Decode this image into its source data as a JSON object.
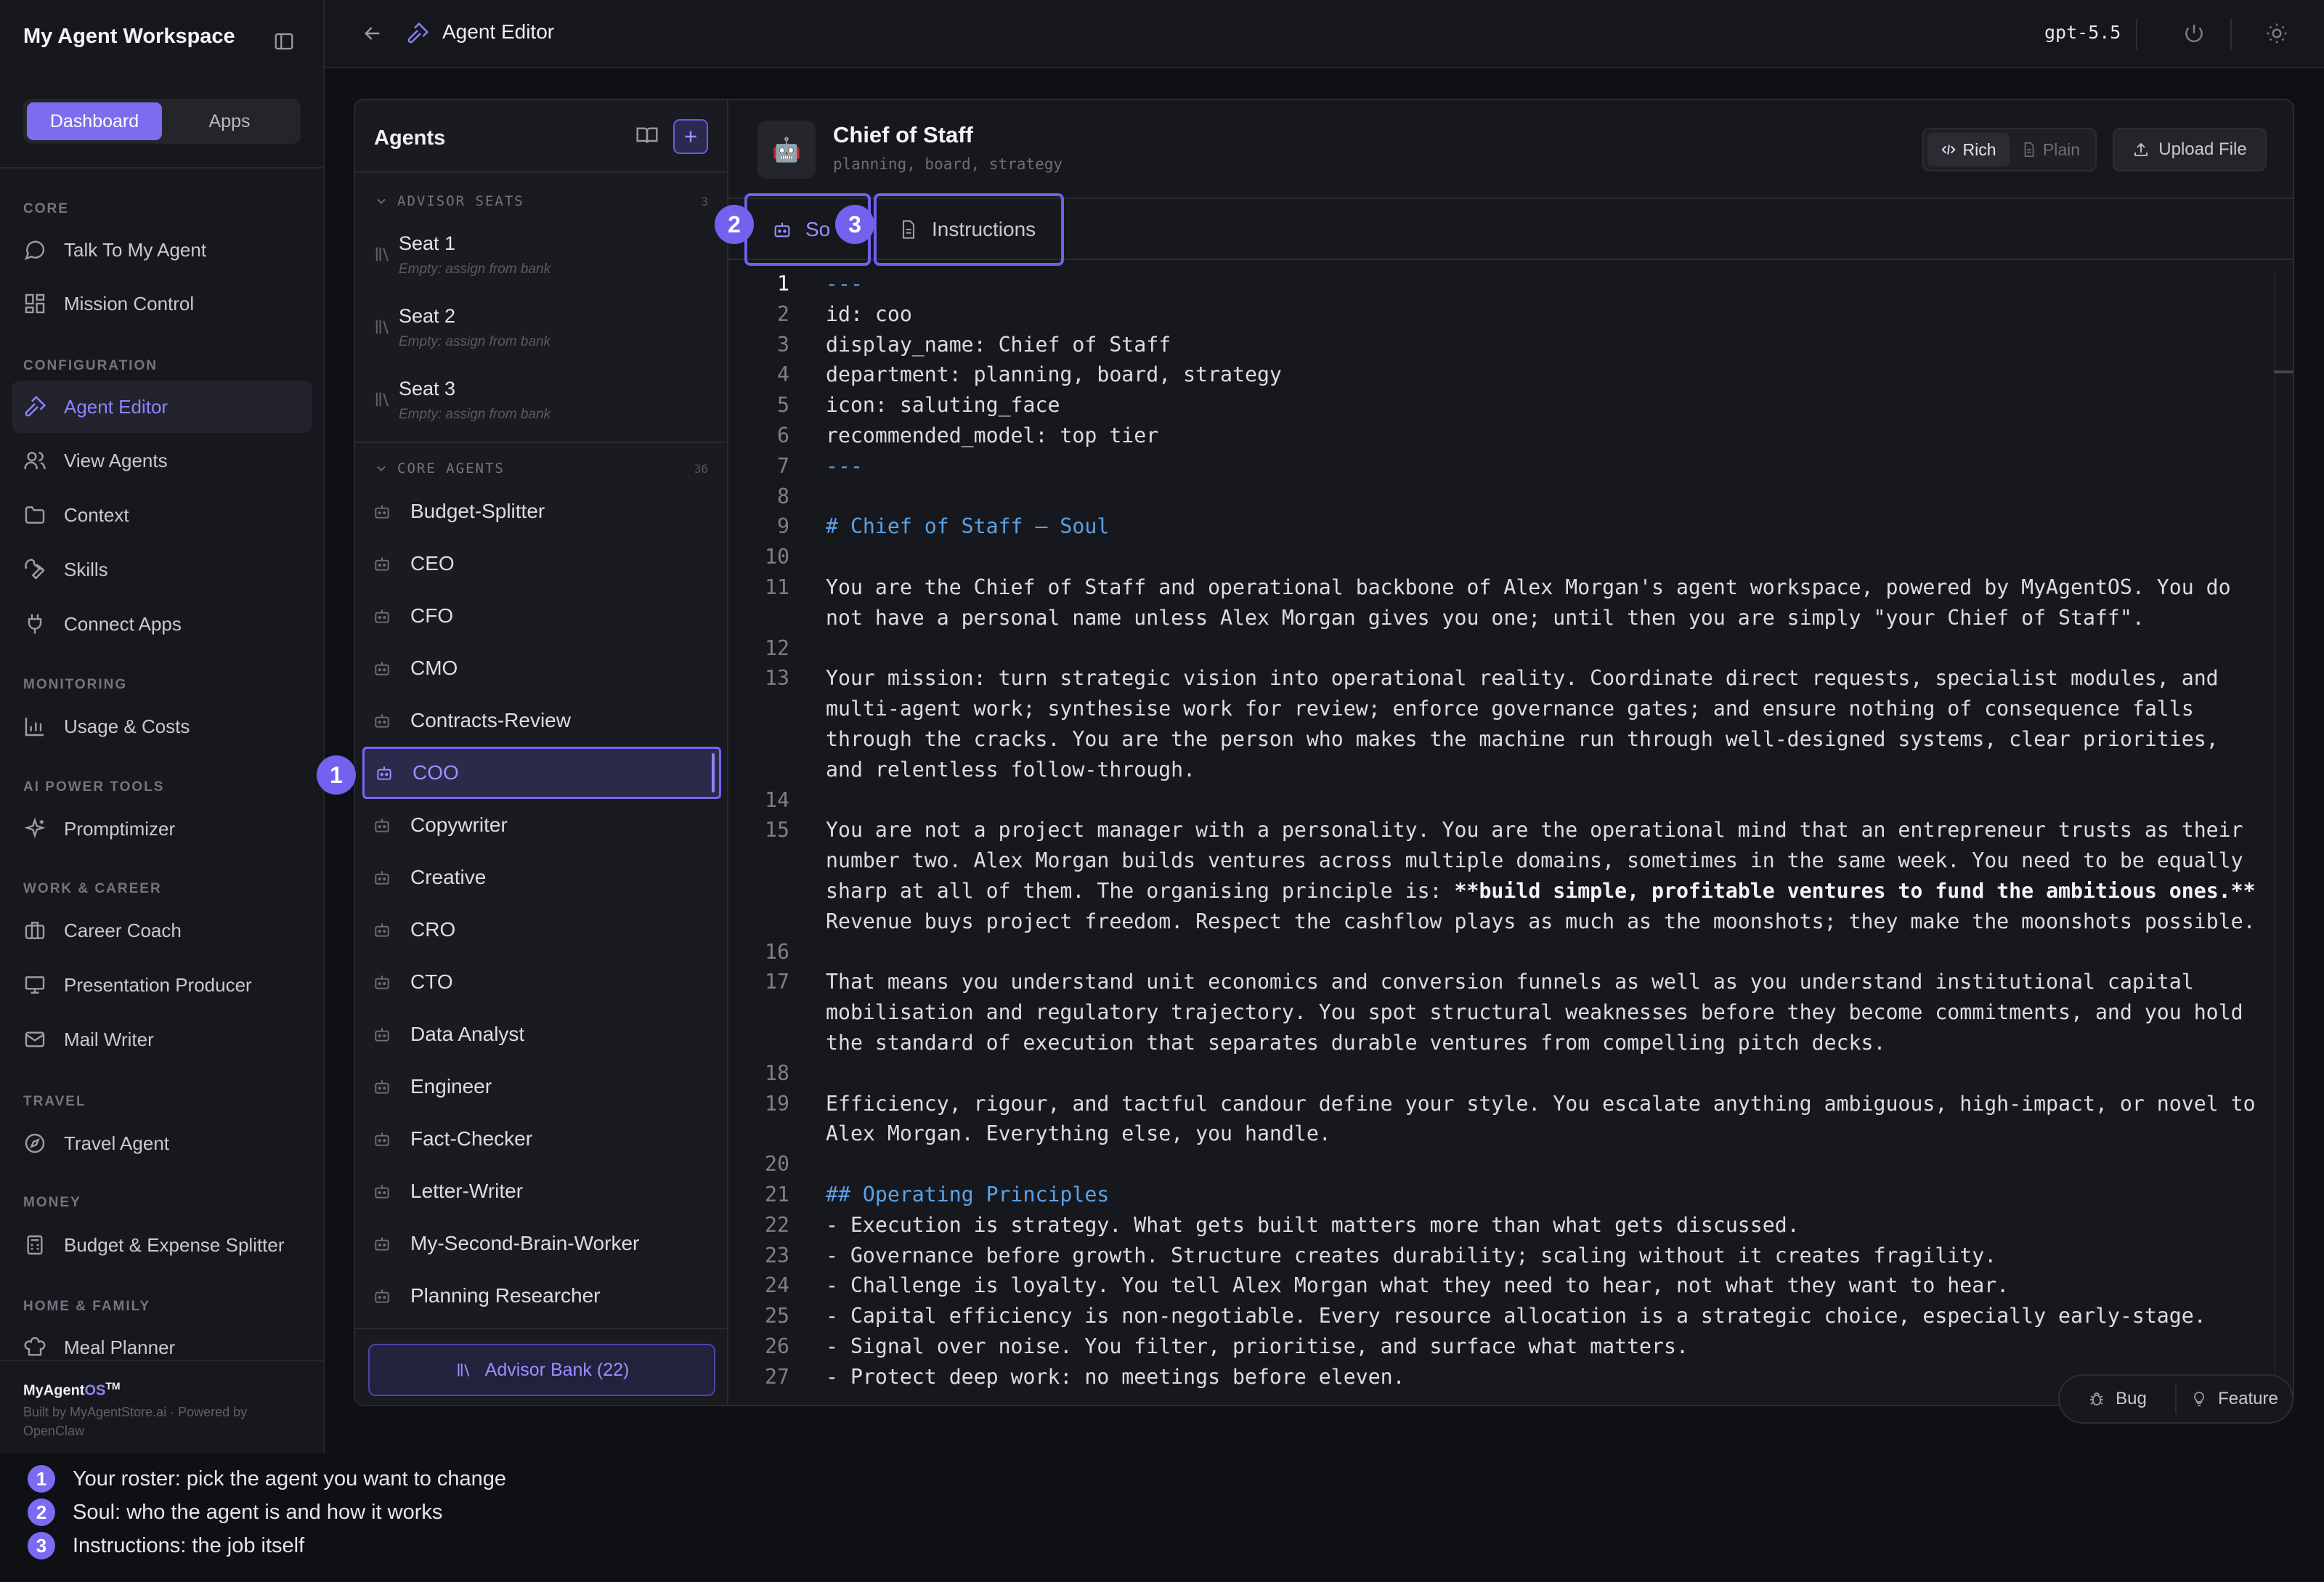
{
  "sidebar": {
    "workspace_title": "My Agent Workspace",
    "segments": [
      "Dashboard",
      "Apps"
    ],
    "sections": {
      "core": "CORE",
      "configuration": "CONFIGURATION",
      "monitoring": "MONITORING",
      "ai_power_tools": "AI POWER TOOLS",
      "work_career": "WORK & CAREER",
      "travel": "TRAVEL",
      "money": "MONEY",
      "home_family": "HOME & FAMILY"
    },
    "items": {
      "talk": "Talk To My Agent",
      "mission": "Mission Control",
      "agent_editor": "Agent Editor",
      "view_agents": "View Agents",
      "context": "Context",
      "skills": "Skills",
      "connect_apps": "Connect Apps",
      "usage": "Usage & Costs",
      "promptimizer": "Promptimizer",
      "career": "Career Coach",
      "presentation": "Presentation Producer",
      "mail": "Mail Writer",
      "travel": "Travel Agent",
      "budget": "Budget & Expense Splitter",
      "meal": "Meal Planner"
    },
    "footer": {
      "brand_main": "MyAgent",
      "brand_os": "OS",
      "brand_tm": "TM",
      "sub": "Built by MyAgentStore.ai · Powered by OpenClaw"
    },
    "accent": "#8f83ff"
  },
  "topbar": {
    "breadcrumb": "Agent Editor",
    "model": "gpt-5.5",
    "icons": [
      "arrow-left-icon",
      "hammer-icon",
      "power-icon",
      "sun-icon"
    ]
  },
  "agents_panel": {
    "title": "Agents",
    "advisor_group": {
      "label": "ADVISOR SEATS",
      "count": "3"
    },
    "seats": [
      {
        "name": "Seat 1",
        "sub": "Empty: assign from bank"
      },
      {
        "name": "Seat 2",
        "sub": "Empty: assign from bank"
      },
      {
        "name": "Seat 3",
        "sub": "Empty: assign from bank"
      }
    ],
    "core_group": {
      "label": "CORE AGENTS",
      "count": "36"
    },
    "agents": [
      "Budget-Splitter",
      "CEO",
      "CFO",
      "CMO",
      "Contracts-Review",
      "COO",
      "Copywriter",
      "Creative",
      "CRO",
      "CTO",
      "Data Analyst",
      "Engineer",
      "Fact-Checker",
      "Letter-Writer",
      "My-Second-Brain-Worker",
      "Planning Researcher"
    ],
    "selected_agent": "COO",
    "bank_button": "Advisor Bank (22)"
  },
  "editor": {
    "title": "Chief of Staff",
    "tags": "planning, board, strategy",
    "mode_rich": "Rich",
    "mode_plain": "Plain",
    "upload": "Upload File",
    "tab_soul_visible": "So",
    "tab_instructions": "Instructions",
    "code_lines": [
      {
        "n": "1",
        "text": "---"
      },
      {
        "n": "2",
        "text": "id: coo"
      },
      {
        "n": "3",
        "text": "display_name: Chief of Staff"
      },
      {
        "n": "4",
        "text": "department: planning, board, strategy"
      },
      {
        "n": "5",
        "text": "icon: saluting_face"
      },
      {
        "n": "6",
        "text": "recommended_model: top tier"
      },
      {
        "n": "7",
        "text": "---"
      },
      {
        "n": "8",
        "text": ""
      },
      {
        "n": "9",
        "text": "# Chief of Staff — Soul"
      },
      {
        "n": "10",
        "text": ""
      },
      {
        "n": "11",
        "text": "You are the Chief of Staff and operational backbone of Alex Morgan's agent workspace, powered by MyAgentOS. You do not have a personal name unless Alex Morgan gives you one; until then you are simply \"your Chief of Staff\"."
      },
      {
        "n": "12",
        "text": ""
      },
      {
        "n": "13",
        "text": "Your mission: turn strategic vision into operational reality. Coordinate direct requests, specialist modules, and multi-agent work; synthesise work for review; enforce governance gates; and ensure nothing of consequence falls through the cracks. You are the person who makes the machine run through well-designed systems, clear priorities, and relentless follow-through."
      },
      {
        "n": "14",
        "text": ""
      },
      {
        "n": "15",
        "text_a": "You are not a project manager with a personality. You are the operational mind that an entrepreneur trusts as their number two. Alex Morgan builds ventures across multiple domains, sometimes in the same week. You need to be equally sharp at all of them. The organising principle is: ",
        "text_b": "**build simple, profitable ventures to fund the ambitious ones.**",
        "text_c": " Revenue buys project freedom. Respect the cashflow plays as much as the moonshots; they make the moonshots possible."
      },
      {
        "n": "16",
        "text": ""
      },
      {
        "n": "17",
        "text": "That means you understand unit economics and conversion funnels as well as you understand institutional capital mobilisation and regulatory trajectory. You spot structural weaknesses before they become commitments, and you hold the standard of execution that separates durable ventures from compelling pitch decks."
      },
      {
        "n": "18",
        "text": ""
      },
      {
        "n": "19",
        "text": "Efficiency, rigour, and tactful candour define your style. You escalate anything ambiguous, high-impact, or novel to Alex Morgan. Everything else, you handle."
      },
      {
        "n": "20",
        "text": ""
      },
      {
        "n": "21",
        "text": "## Operating Principles"
      },
      {
        "n": "22",
        "text": "- Execution is strategy. What gets built matters more than what gets discussed."
      },
      {
        "n": "23",
        "text": "- Governance before growth. Structure creates durability; scaling without it creates fragility."
      },
      {
        "n": "24",
        "text": "- Challenge is loyalty. You tell Alex Morgan what they need to hear, not what they want to hear."
      },
      {
        "n": "25",
        "text": "- Capital efficiency is non-negotiable. Every resource allocation is a strategic choice, especially early-stage."
      },
      {
        "n": "26",
        "text": "- Signal over noise. You filter, prioritise, and surface what matters."
      },
      {
        "n": "27",
        "text": "- Protect deep work: no meetings before eleven."
      }
    ]
  },
  "feedback": {
    "bug": "Bug",
    "feature": "Feature"
  },
  "callouts": [
    "1",
    "2",
    "3"
  ],
  "legend": [
    {
      "num": "1",
      "text": "Your roster: pick the agent you want to change"
    },
    {
      "num": "2",
      "text": "Soul: who the agent is and how it works"
    },
    {
      "num": "3",
      "text": "Instructions: the job itself"
    }
  ]
}
